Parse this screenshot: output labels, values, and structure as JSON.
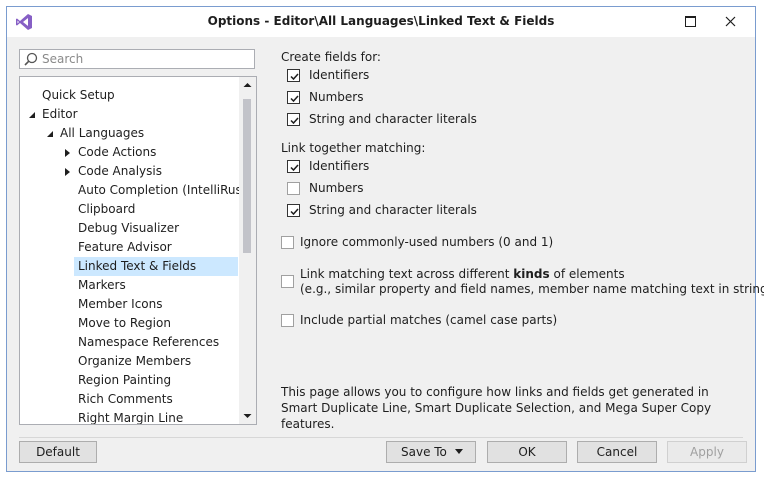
{
  "window": {
    "title": "Options - Editor\\All Languages\\Linked Text & Fields",
    "accent": "#7a9ccf"
  },
  "search": {
    "placeholder": "Search",
    "value": ""
  },
  "tree": {
    "items": [
      {
        "label": "Quick Setup",
        "level": 1,
        "arrow": "none",
        "selected": false
      },
      {
        "label": "Editor",
        "level": 1,
        "arrow": "expanded",
        "selected": false
      },
      {
        "label": "All Languages",
        "level": 2,
        "arrow": "expanded",
        "selected": false
      },
      {
        "label": "Code Actions",
        "level": 3,
        "arrow": "collapsed",
        "selected": false
      },
      {
        "label": "Code Analysis",
        "level": 3,
        "arrow": "collapsed",
        "selected": false
      },
      {
        "label": "Auto Completion (IntelliRush)",
        "level": 3,
        "arrow": "none",
        "selected": false
      },
      {
        "label": "Clipboard",
        "level": 3,
        "arrow": "none",
        "selected": false
      },
      {
        "label": "Debug Visualizer",
        "level": 3,
        "arrow": "none",
        "selected": false
      },
      {
        "label": "Feature Advisor",
        "level": 3,
        "arrow": "none",
        "selected": false
      },
      {
        "label": "Linked Text & Fields",
        "level": 3,
        "arrow": "none",
        "selected": true
      },
      {
        "label": "Markers",
        "level": 3,
        "arrow": "none",
        "selected": false
      },
      {
        "label": "Member Icons",
        "level": 3,
        "arrow": "none",
        "selected": false
      },
      {
        "label": "Move to Region",
        "level": 3,
        "arrow": "none",
        "selected": false
      },
      {
        "label": "Namespace References",
        "level": 3,
        "arrow": "none",
        "selected": false
      },
      {
        "label": "Organize Members",
        "level": 3,
        "arrow": "none",
        "selected": false
      },
      {
        "label": "Region Painting",
        "level": 3,
        "arrow": "none",
        "selected": false
      },
      {
        "label": "Rich Comments",
        "level": 3,
        "arrow": "none",
        "selected": false
      },
      {
        "label": "Right Margin Line",
        "level": 3,
        "arrow": "none",
        "selected": false
      }
    ],
    "selected_color": "#cce8ff"
  },
  "create_fields": {
    "label": "Create fields for:",
    "identifiers": {
      "label": "Identifiers",
      "checked": true
    },
    "numbers": {
      "label": "Numbers",
      "checked": true
    },
    "strings": {
      "label": "String and character literals",
      "checked": true
    }
  },
  "link_together": {
    "label": "Link together matching:",
    "identifiers": {
      "label": "Identifiers",
      "checked": true
    },
    "numbers": {
      "label": "Numbers",
      "checked": false
    },
    "strings": {
      "label": "String and character literals",
      "checked": true
    }
  },
  "options": {
    "ignore_numbers": {
      "label": "Ignore commonly-used numbers (0 and 1)",
      "checked": false
    },
    "link_kinds": {
      "label_before": "Link matching text across different ",
      "label_bold": "kinds",
      "label_after": " of elements",
      "sub": "(e.g., similar property and field names, member name matching text in string, etc.)",
      "checked": false
    },
    "partial_matches": {
      "label": "Include partial matches (camel case parts)",
      "checked": false
    }
  },
  "help": {
    "text": "This page allows you to configure how links and fields get generated in Smart Duplicate Line, Smart Duplicate Selection, and Mega Super Copy features."
  },
  "buttons": {
    "default": "Default",
    "save_to": "Save To",
    "ok": "OK",
    "cancel": "Cancel",
    "apply": "Apply"
  }
}
